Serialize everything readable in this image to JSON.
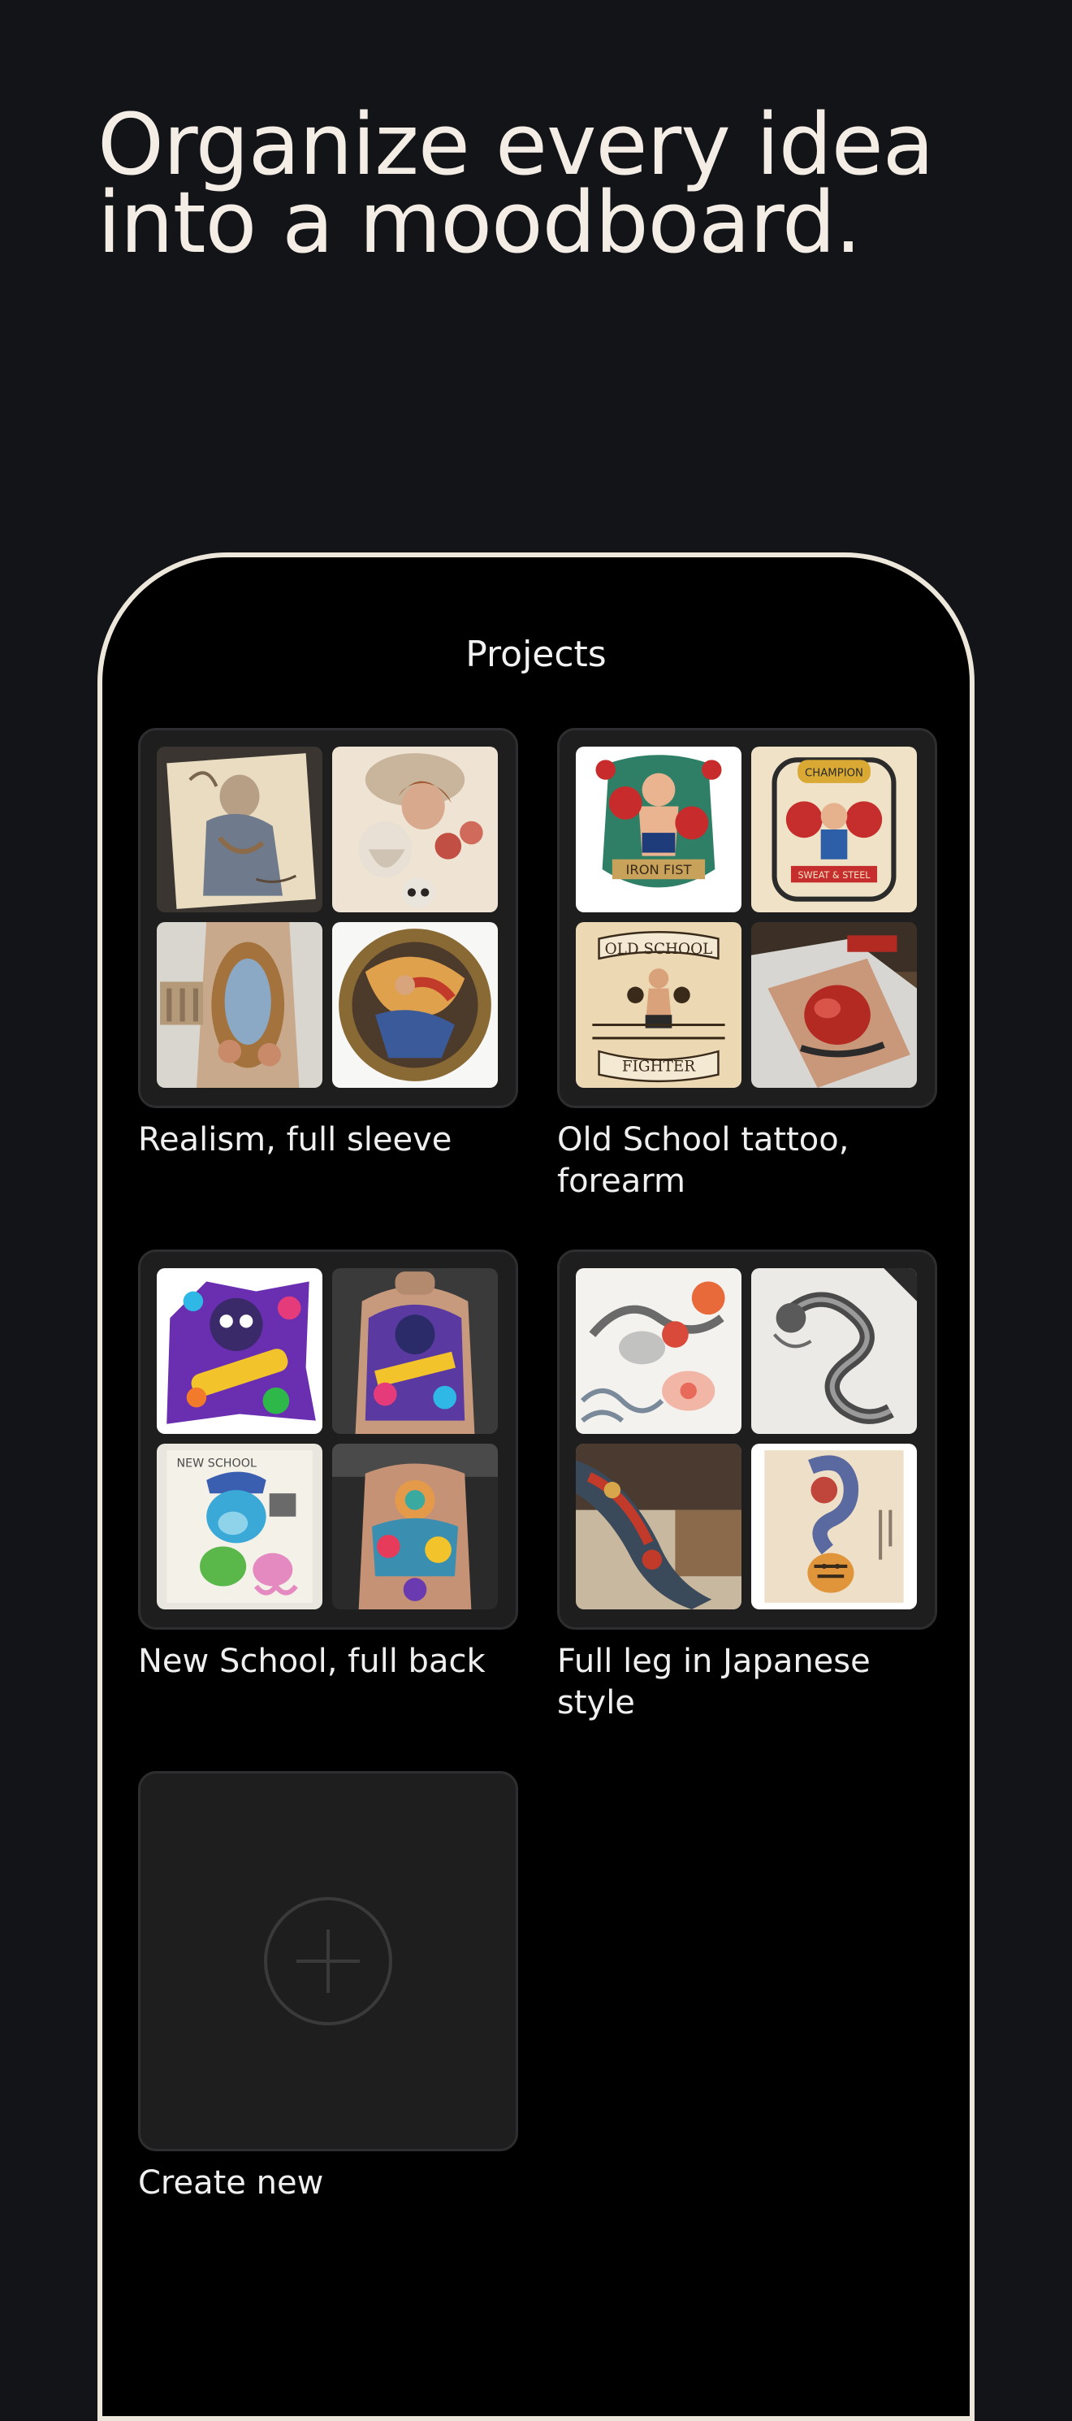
{
  "headline": {
    "line1": "Organize every idea",
    "line2": "into a moodboard."
  },
  "screen": {
    "title": "Projects"
  },
  "projects": [
    {
      "name": "Realism, full sleeve",
      "thumbnails": [
        "realism-sketch-angel",
        "realism-sculpture-skull-roses",
        "realism-sleeve-on-arm",
        "realism-ornamental-circle"
      ]
    },
    {
      "name": "Old School tattoo, forearm",
      "thumbnails": [
        "iron-fist-boxer-flash",
        "champion-boxing-glove-flash",
        "old-school-fighter-flash",
        "boxing-glove-forearm-tattoo"
      ]
    },
    {
      "name": "New School, full back",
      "thumbnails": [
        "graffiti-gorilla-flash",
        "new-school-back-tattoo",
        "new-school-sketchbook-gorilla",
        "colorful-back-piece-tattoo"
      ]
    },
    {
      "name": "Full leg in Japanese style",
      "thumbnails": [
        "dragon-waves-peony-sketch",
        "pencil-dragon-sketch",
        "japanese-full-leg-tattoo",
        "dragon-tiger-scroll-design"
      ]
    }
  ],
  "create": {
    "label": "Create new",
    "icon": "plus-circle-icon"
  },
  "colors": {
    "background": "#131418",
    "phone_screen": "#000000",
    "phone_frame": "#ece6db",
    "card": "#1e1e1f",
    "text": "#efefef"
  }
}
